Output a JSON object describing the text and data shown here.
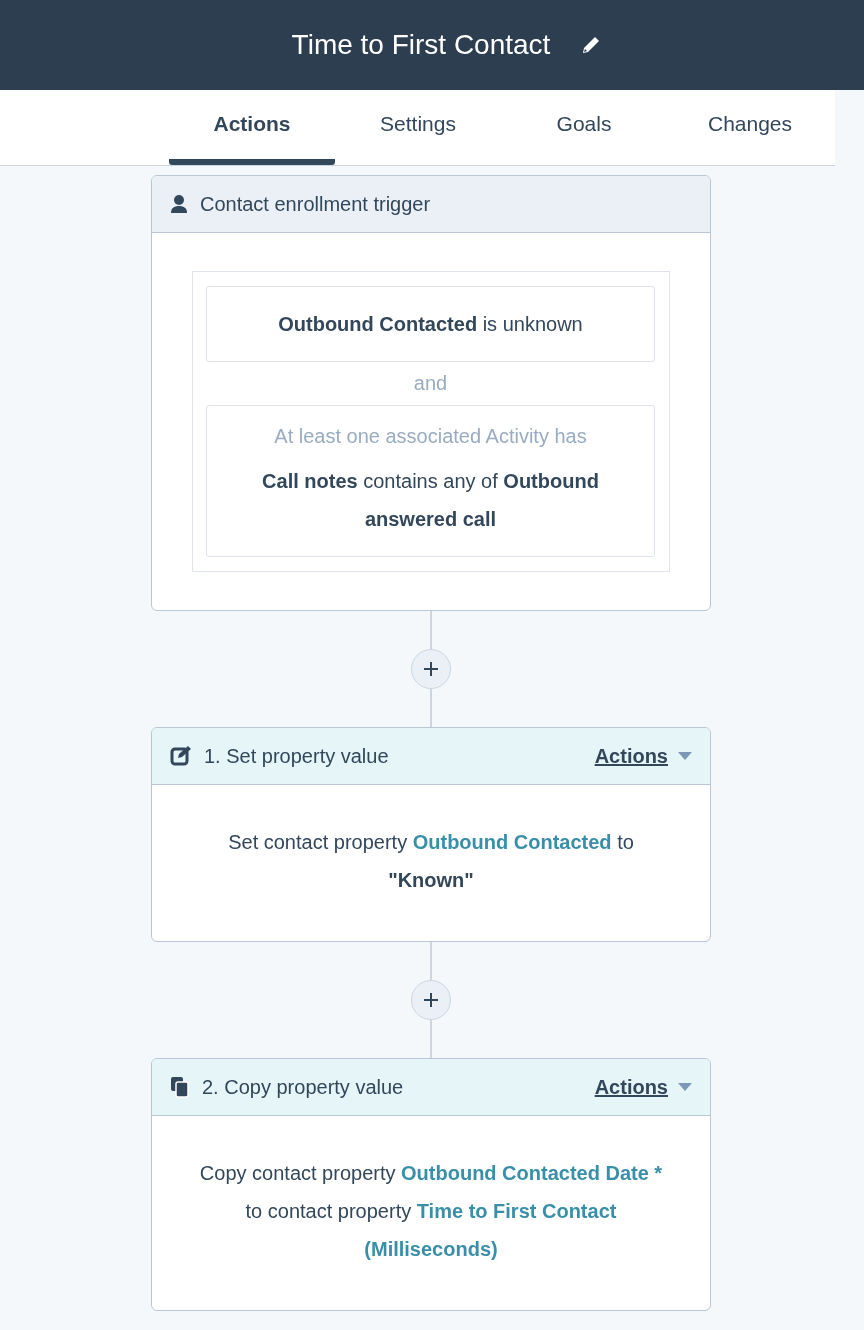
{
  "header": {
    "title": "Time to First Contact"
  },
  "tabs": [
    {
      "label": "Actions",
      "selected": true
    },
    {
      "label": "Settings",
      "selected": false
    },
    {
      "label": "Goals",
      "selected": false
    },
    {
      "label": "Changes",
      "selected": false
    }
  ],
  "trigger": {
    "title": "Contact enrollment trigger",
    "filters": [
      {
        "lines": [
          "**Outbound Contacted** is unknown"
        ]
      },
      {
        "subtitle": "At least one associated Activity has",
        "lines": [
          "**Call notes** contains any of **Outbound answered call**"
        ]
      }
    ],
    "joiner": "and"
  },
  "actions": [
    {
      "kind": "edit",
      "title": "1. Set property value",
      "menu": "Actions",
      "segments": [
        {
          "kind": "plain",
          "text": "Set contact property "
        },
        {
          "kind": "property",
          "text": "Outbound Contacted"
        },
        {
          "kind": "plain",
          "text": " to "
        },
        {
          "kind": "value",
          "text": "\"Known\""
        }
      ]
    },
    {
      "kind": "copy",
      "title": "2. Copy property value",
      "menu": "Actions",
      "segments": [
        {
          "kind": "plain",
          "text": "Copy contact property "
        },
        {
          "kind": "property",
          "text": "Outbound Contacted Date *"
        },
        {
          "kind": "plain",
          "text": " to contact property "
        },
        {
          "kind": "property",
          "text": "Time to First Contact (Milliseconds)"
        }
      ]
    }
  ]
}
